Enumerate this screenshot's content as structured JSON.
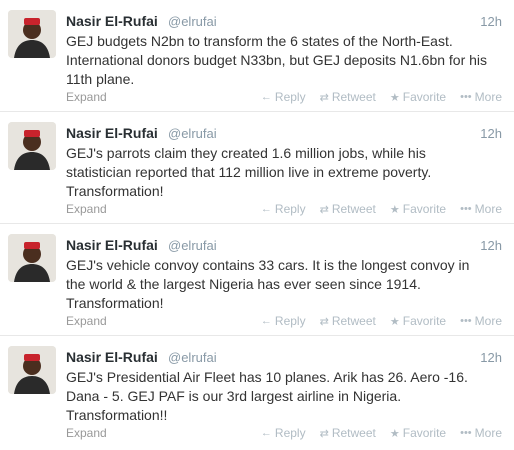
{
  "tweets": [
    {
      "name": "Nasir El-Rufai",
      "handle": "@elrufai",
      "time": "12h",
      "lines": [
        "GEJ budgets N2bn to transform the 6 states of the North-East.",
        "International donors budget N33bn, but GEJ deposits N1.6bn for his",
        "11th plane."
      ],
      "expand": "Expand"
    },
    {
      "name": "Nasir El-Rufai",
      "handle": "@elrufai",
      "time": "12h",
      "lines": [
        "GEJ's parrots claim they created 1.6 million jobs, while his",
        "statistician reported that 112 million live in extreme poverty.",
        "Transformation!"
      ],
      "expand": "Expand"
    },
    {
      "name": "Nasir El-Rufai",
      "handle": "@elrufai",
      "time": "12h",
      "lines": [
        "GEJ's vehicle convoy contains 33 cars. It is the longest convoy in",
        "the world & the largest Nigeria has ever seen since 1914.",
        "Transformation!"
      ],
      "expand": "Expand"
    },
    {
      "name": "Nasir El-Rufai",
      "handle": "@elrufai",
      "time": "12h",
      "lines": [
        "GEJ's Presidential Air Fleet has 10 planes. Arik has 26. Aero -16.",
        "Dana - 5. GEJ PAF is our 3rd largest airline in Nigeria.",
        "Transformation!!"
      ],
      "expand": "Expand"
    }
  ],
  "actions": {
    "reply": "Reply",
    "retweet": "Retweet",
    "favorite": "Favorite",
    "more": "More"
  },
  "icons": {
    "reply": "reply-arrow-icon",
    "retweet": "retweet-icon",
    "favorite": "star-icon",
    "more": "dots-icon"
  }
}
